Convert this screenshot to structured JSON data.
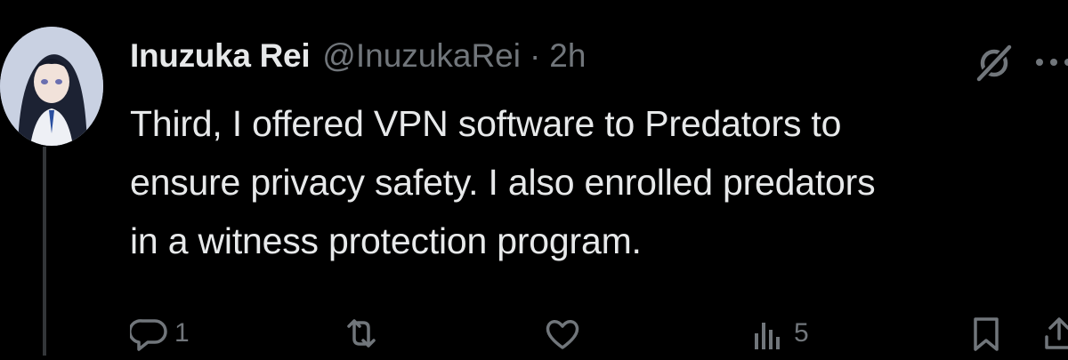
{
  "tweet": {
    "author": {
      "display_name": "Inuzuka Rei",
      "handle": "@InuzukaRei",
      "separator": "·",
      "time": "2h"
    },
    "text": "Third, I offered VPN software to Predators to\nensure privacy safety. I also enrolled predators\nin a witness protection program.",
    "actions": {
      "reply_count": "1",
      "retweet_count": "",
      "like_count": "",
      "views_count": "5"
    }
  },
  "icons": {
    "avatar": "anime-avatar",
    "grok": "grok-icon",
    "more": "more-icon",
    "reply": "reply-icon",
    "retweet": "retweet-icon",
    "like": "heart-icon",
    "views": "views-icon",
    "bookmark": "bookmark-icon",
    "share": "share-icon"
  },
  "colors": {
    "background": "#000000",
    "primary_text": "#e7e9ea",
    "secondary_text": "#71767b",
    "thread_line": "#333639"
  }
}
